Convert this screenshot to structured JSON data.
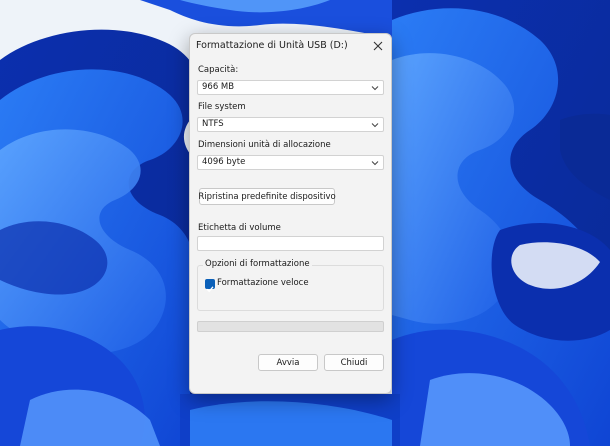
{
  "dialog": {
    "title": "Formattazione di Unità USB (D:)",
    "close_icon": "close-icon"
  },
  "capacity": {
    "label": "Capacità:",
    "value": "966 MB"
  },
  "filesystem": {
    "label": "File system",
    "value": "NTFS"
  },
  "allocation": {
    "label": "Dimensioni unità di allocazione",
    "value": "4096 byte"
  },
  "restore_button": {
    "label": "Ripristina predefinite dispositivo"
  },
  "volume_label": {
    "label": "Etichetta di volume",
    "value": ""
  },
  "format_options": {
    "legend": "Opzioni di formattazione",
    "quick_format": {
      "label": "Formattazione veloce",
      "checked": true
    }
  },
  "progress": {
    "fraction": 0
  },
  "buttons": {
    "start": "Avvia",
    "close": "Chiudi"
  },
  "colors": {
    "accent": "#0a5fb8",
    "wallpaper_primary": "#1a56e0",
    "wallpaper_background": "#eef3f9"
  }
}
